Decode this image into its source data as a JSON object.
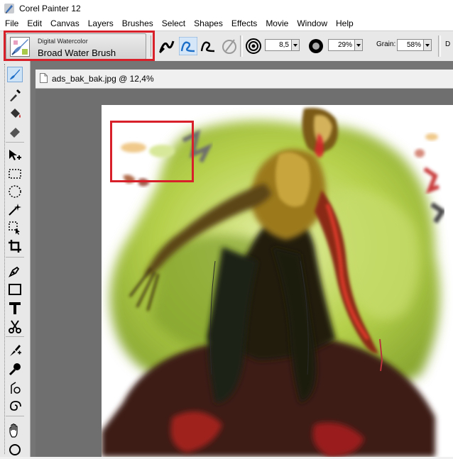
{
  "window": {
    "title": "Corel Painter 12"
  },
  "menu": [
    "File",
    "Edit",
    "Canvas",
    "Layers",
    "Brushes",
    "Select",
    "Shapes",
    "Effects",
    "Movie",
    "Window",
    "Help"
  ],
  "property_bar": {
    "brush_category": "Digital Watercolor",
    "brush_variant": "Broad Water Brush",
    "size_value": "8,5",
    "opacity_value": "29%",
    "grain_label": "Grain:",
    "grain_value": "58%",
    "next_truncated": "D"
  },
  "document": {
    "tab_title": "ads_bak_bak.jpg @ 12,4%"
  },
  "colors": {
    "highlight": "#d7202a",
    "active_tool": "#cfe3f7",
    "accent_blue": "#1e6fc8"
  }
}
